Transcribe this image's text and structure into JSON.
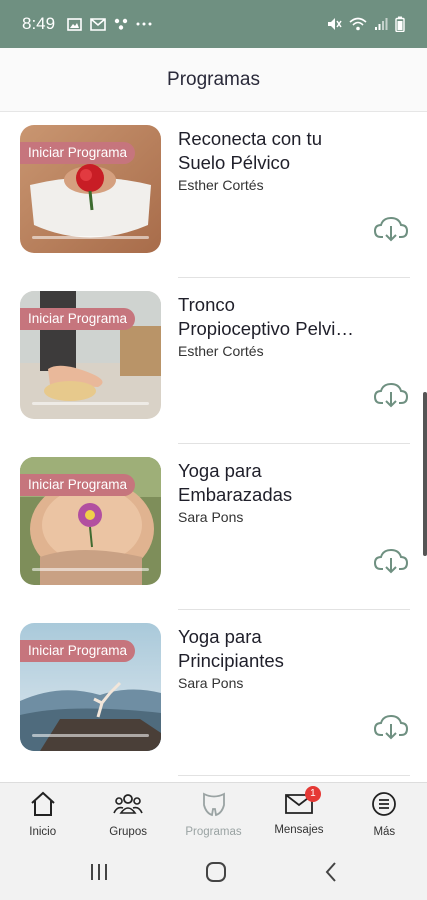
{
  "status_bar": {
    "time": "8:49",
    "color": "#6f9081"
  },
  "header": {
    "title": "Programas"
  },
  "programs": [
    {
      "badge": "Iniciar Programa",
      "name": "Reconecta con tu Suelo Pélvico",
      "name_line1": "Reconecta con tu",
      "name_line2": "Suelo Pélvico",
      "author": "Esther Cortés",
      "download_icon": "cloud-download-icon"
    },
    {
      "badge": "Iniciar Programa",
      "name": "Tronco Propioceptivo Pelvi…",
      "name_line1": "Tronco",
      "name_line2": "Propioceptivo Pelvi…",
      "author": "Esther Cortés",
      "download_icon": "cloud-download-icon"
    },
    {
      "badge": "Iniciar Programa",
      "name": "Yoga para Embarazadas",
      "name_line1": "Yoga para",
      "name_line2": "Embarazadas",
      "author": "Sara Pons",
      "download_icon": "cloud-download-icon"
    },
    {
      "badge": "Iniciar Programa",
      "name": "Yoga para Principiantes",
      "name_line1": "Yoga para",
      "name_line2": "Principiantes",
      "author": "Sara Pons",
      "download_icon": "cloud-download-icon"
    }
  ],
  "tabbar": {
    "tabs": [
      {
        "label": "Inicio",
        "icon": "home-icon"
      },
      {
        "label": "Grupos",
        "icon": "group-icon"
      },
      {
        "label": "Programas",
        "icon": "pelvis-icon",
        "active": true
      },
      {
        "label": "Mensajes",
        "icon": "mail-icon",
        "badge": "1"
      },
      {
        "label": "Más",
        "icon": "menu-icon"
      }
    ]
  },
  "colors": {
    "accent": "#6f9081",
    "badge": "#c6757d",
    "notification": "#e53935"
  }
}
